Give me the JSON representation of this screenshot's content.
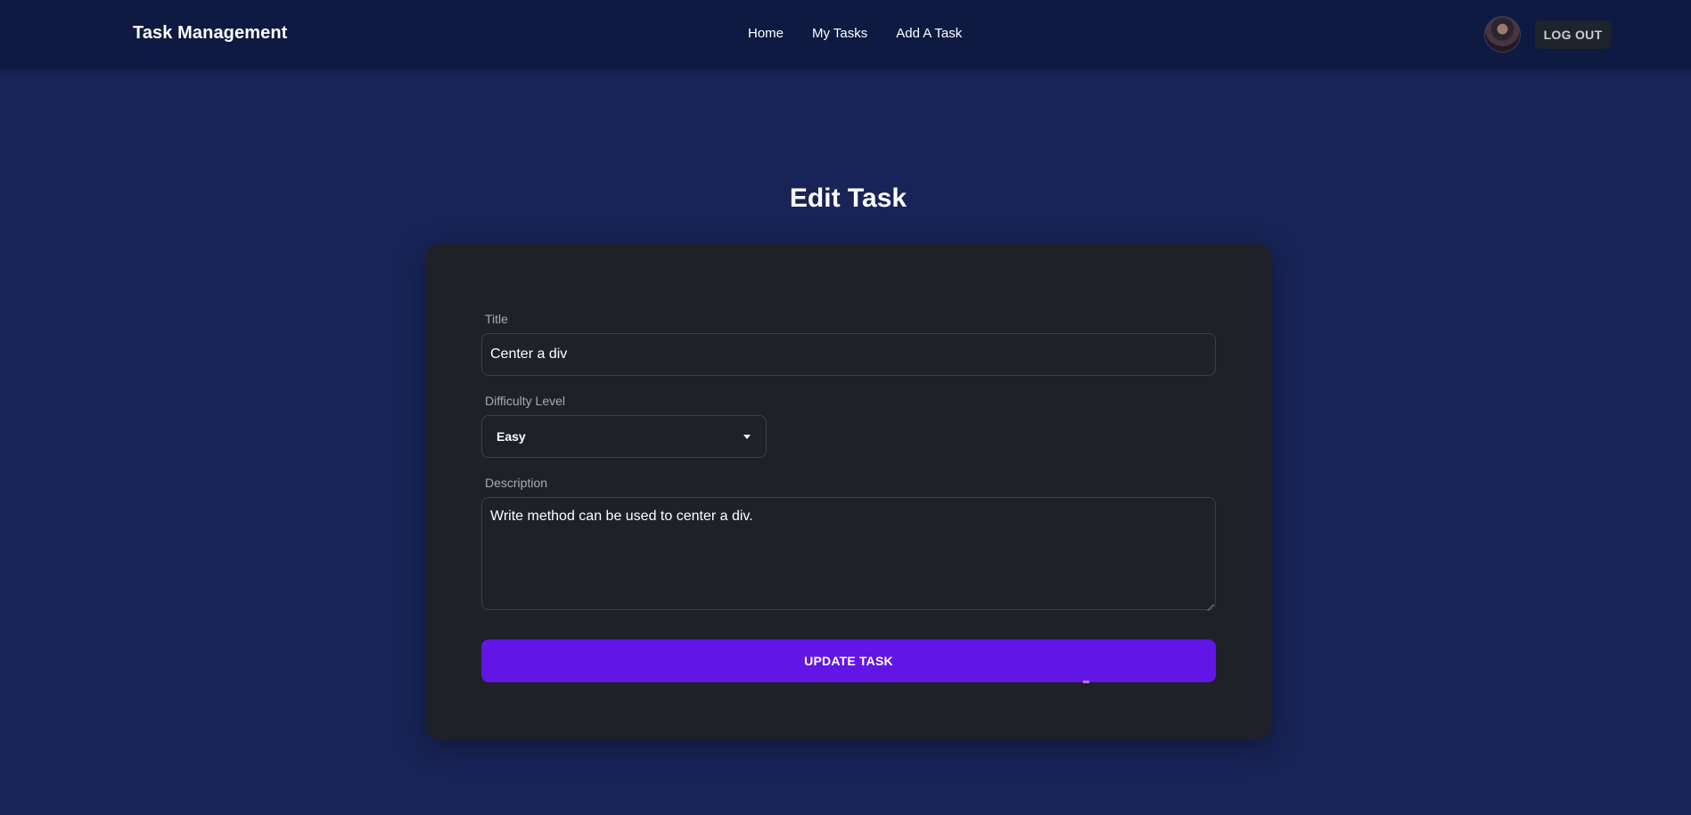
{
  "navbar": {
    "brand": "Task Management",
    "links": [
      "Home",
      "My Tasks",
      "Add A Task"
    ],
    "logout_label": "LOG OUT"
  },
  "page": {
    "title": "Edit Task"
  },
  "form": {
    "title_label": "Title",
    "title_value": "Center a div",
    "difficulty_label": "Difficulty Level",
    "difficulty_value": "Easy",
    "description_label": "Description",
    "description_value": "Write method can be used to center a div.",
    "submit_label": "UPDATE TASK"
  },
  "colors": {
    "page_background": "#182457",
    "navbar_background": "#0f1a42",
    "card_background": "#1e2128",
    "accent": "#6116e6"
  }
}
